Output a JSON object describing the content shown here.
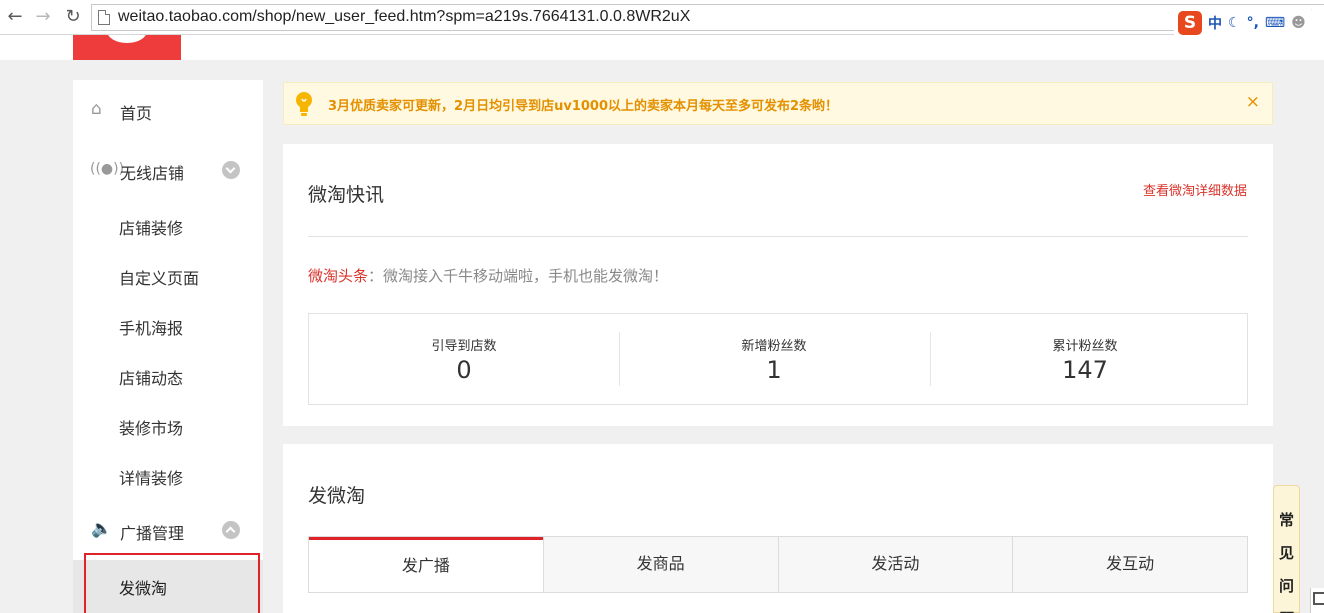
{
  "browser": {
    "url": "weitao.taobao.com/shop/new_user_feed.htm?spm=a219s.7664131.0.0.8WR2uX"
  },
  "ime": {
    "logo": "S",
    "lang": "中"
  },
  "sidebar": {
    "home": "首页",
    "wireless_shop": "无线店铺",
    "wireless_items": [
      "店铺装修",
      "自定义页面",
      "手机海报",
      "店铺动态",
      "装修市场",
      "详情装修"
    ],
    "broadcast": "广播管理",
    "active_item": "发微淘"
  },
  "notice": {
    "text": "3月优质卖家可更新，2月日均引导到店uv1000以上的卖家本月每天至多可发布2条哟！",
    "close": "×"
  },
  "feed": {
    "title": "微淘快讯",
    "detail_link": "查看微淘详细数据",
    "headline_tag": "微淘头条",
    "headline_text": "：微淘接入千牛移动端啦，手机也能发微淘！",
    "stats": [
      {
        "label": "引导到店数",
        "value": "0"
      },
      {
        "label": "新增粉丝数",
        "value": "1"
      },
      {
        "label": "累计粉丝数",
        "value": "147"
      }
    ]
  },
  "post": {
    "title": "发微淘",
    "tabs": [
      "发广播",
      "发商品",
      "发活动",
      "发互动"
    ],
    "active_tab": 0
  },
  "faq": {
    "chars": [
      "常",
      "见",
      "问",
      "题"
    ]
  },
  "colors": {
    "accent_red": "#e0232b",
    "notice_text": "#e49000",
    "notice_bg": "#fef9e0"
  },
  "icons": {
    "home": "home-icon",
    "wireless": "signal-icon",
    "broadcast": "speaker-icon",
    "notice": "lightbulb-icon"
  }
}
